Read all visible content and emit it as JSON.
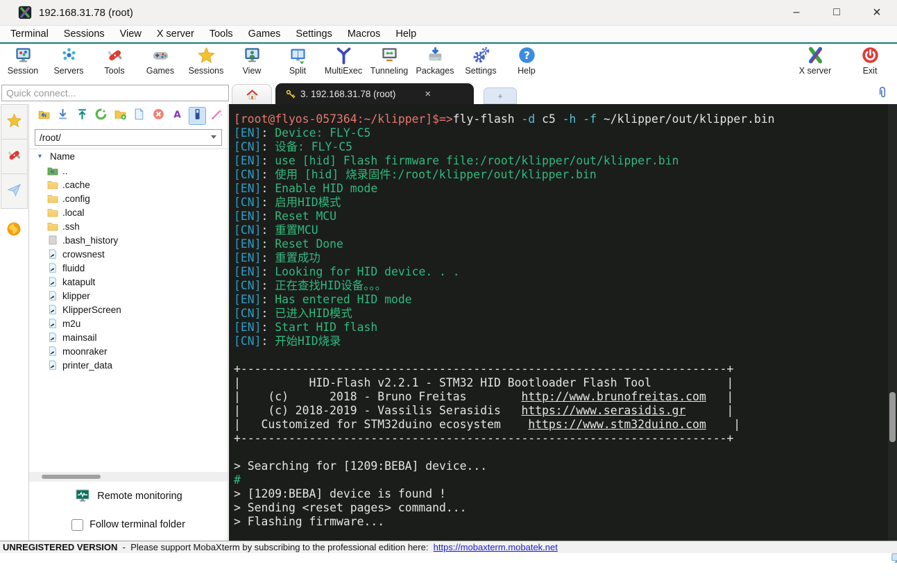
{
  "window": {
    "title": "192.168.31.78 (root)",
    "controls": {
      "minimize": "–",
      "maximize": "□",
      "close": "×"
    }
  },
  "colors": {
    "accent_teal": "#147c7c",
    "terminal_background": "#1b1d1b",
    "prompt_salmon": "#e8796e",
    "tag_blue": "#2d9dc4",
    "text_green": "#2eba7e",
    "flag_cyan": "#4fc3dc",
    "terminal_white": "#e4e4e4",
    "link_blue": "#1b1bd6"
  },
  "menubar": {
    "items": [
      {
        "label": "Terminal"
      },
      {
        "label": "Sessions"
      },
      {
        "label": "View"
      },
      {
        "label": "X server"
      },
      {
        "label": "Tools"
      },
      {
        "label": "Games"
      },
      {
        "label": "Settings"
      },
      {
        "label": "Macros"
      },
      {
        "label": "Help"
      }
    ]
  },
  "toolbar": {
    "buttons": [
      {
        "label": "Session",
        "icon": "session-monitor-icon"
      },
      {
        "label": "Servers",
        "icon": "servers-network-icon"
      },
      {
        "label": "Tools",
        "icon": "swiss-knife-icon"
      },
      {
        "label": "Games",
        "icon": "gamepad-icon"
      },
      {
        "label": "Sessions",
        "icon": "star-icon"
      },
      {
        "label": "View",
        "icon": "view-monitor-icon"
      },
      {
        "label": "Split",
        "icon": "split-window-icon"
      },
      {
        "label": "MultiExec",
        "icon": "multiexec-y-icon"
      },
      {
        "label": "Tunneling",
        "icon": "tunneling-monitor-icon"
      },
      {
        "label": "Packages",
        "icon": "packages-drive-icon"
      },
      {
        "label": "Settings",
        "icon": "gears-icon"
      },
      {
        "label": "Help",
        "icon": "help-circle-icon"
      }
    ],
    "right_buttons": [
      {
        "label": "X server",
        "icon": "xserver-x-icon"
      },
      {
        "label": "Exit",
        "icon": "power-icon"
      }
    ]
  },
  "quick_connect": {
    "placeholder": "Quick connect..."
  },
  "tabs": {
    "active": {
      "label": "3. 192.168.31.78 (root)",
      "close_glyph": "×"
    },
    "new_tab_glyph": "+"
  },
  "sidebar": {
    "rail": [
      {
        "name": "sessions",
        "icon": "star-icon"
      },
      {
        "name": "tools",
        "icon": "swiss-knife-icon"
      },
      {
        "name": "macros",
        "icon": "paper-plane-icon"
      },
      {
        "name": "sftp",
        "icon": "globe-icon"
      }
    ],
    "filebar": [
      {
        "icon": "parent-folder-icon"
      },
      {
        "icon": "download-icon"
      },
      {
        "icon": "upload-icon"
      },
      {
        "icon": "refresh-icon"
      },
      {
        "icon": "new-folder-icon"
      },
      {
        "icon": "new-file-icon"
      },
      {
        "icon": "delete-icon"
      },
      {
        "icon": "font-icon"
      },
      {
        "icon": "sync-icon",
        "selected": true
      },
      {
        "icon": "wand-icon"
      }
    ],
    "path": "/root/",
    "tree": {
      "header": "Name",
      "rows": [
        {
          "label": "..",
          "icon": "parent-dir-icon"
        },
        {
          "label": ".cache",
          "icon": "folder-icon"
        },
        {
          "label": ".config",
          "icon": "folder-icon"
        },
        {
          "label": ".local",
          "icon": "folder-icon"
        },
        {
          "label": ".ssh",
          "icon": "folder-icon"
        },
        {
          "label": ".bash_history",
          "icon": "file-icon"
        },
        {
          "label": "crowsnest",
          "icon": "symlink-icon"
        },
        {
          "label": "fluidd",
          "icon": "symlink-icon"
        },
        {
          "label": "katapult",
          "icon": "symlink-icon"
        },
        {
          "label": "klipper",
          "icon": "symlink-icon"
        },
        {
          "label": "KlipperScreen",
          "icon": "symlink-icon"
        },
        {
          "label": "m2u",
          "icon": "symlink-icon"
        },
        {
          "label": "mainsail",
          "icon": "symlink-icon"
        },
        {
          "label": "moonraker",
          "icon": "symlink-icon"
        },
        {
          "label": "printer_data",
          "icon": "symlink-icon"
        }
      ]
    },
    "remote_monitoring_label": "Remote monitoring",
    "follow_terminal_label": "Follow terminal folder"
  },
  "terminal": {
    "lines": [
      {
        "segments": [
          {
            "t": "[root@flyos-057364:~/klipper]$=>",
            "c": "p"
          },
          {
            "t": "fly-flash ",
            "c": "w"
          },
          {
            "t": "-d ",
            "c": "c"
          },
          {
            "t": "c5 ",
            "c": "w"
          },
          {
            "t": "-h ",
            "c": "c"
          },
          {
            "t": "-f ",
            "c": "c"
          },
          {
            "t": "~/klipper/out/klipper.bin",
            "c": "w"
          }
        ]
      },
      {
        "segments": [
          {
            "t": "[EN]",
            "c": "b"
          },
          {
            "t": ": ",
            "c": "w"
          },
          {
            "t": "Device: FLY-C5",
            "c": "g"
          }
        ]
      },
      {
        "segments": [
          {
            "t": "[CN]",
            "c": "b"
          },
          {
            "t": ": ",
            "c": "w"
          },
          {
            "t": "设备: FLY-C5",
            "c": "g"
          }
        ]
      },
      {
        "segments": [
          {
            "t": "[EN]",
            "c": "b"
          },
          {
            "t": ": ",
            "c": "w"
          },
          {
            "t": "use [hid] Flash firmware file:/root/klipper/out/klipper.bin",
            "c": "g"
          }
        ]
      },
      {
        "segments": [
          {
            "t": "[CN]",
            "c": "b"
          },
          {
            "t": ": ",
            "c": "w"
          },
          {
            "t": "使用 [hid] 烧录固件:/root/klipper/out/klipper.bin",
            "c": "g"
          }
        ]
      },
      {
        "segments": [
          {
            "t": "[EN]",
            "c": "b"
          },
          {
            "t": ": ",
            "c": "w"
          },
          {
            "t": "Enable HID mode",
            "c": "g"
          }
        ]
      },
      {
        "segments": [
          {
            "t": "[CN]",
            "c": "b"
          },
          {
            "t": ": ",
            "c": "w"
          },
          {
            "t": "启用HID模式",
            "c": "g"
          }
        ]
      },
      {
        "segments": [
          {
            "t": "[EN]",
            "c": "b"
          },
          {
            "t": ": ",
            "c": "w"
          },
          {
            "t": "Reset MCU",
            "c": "g"
          }
        ]
      },
      {
        "segments": [
          {
            "t": "[CN]",
            "c": "b"
          },
          {
            "t": ": ",
            "c": "w"
          },
          {
            "t": "重置MCU",
            "c": "g"
          }
        ]
      },
      {
        "segments": [
          {
            "t": "[EN]",
            "c": "b"
          },
          {
            "t": ": ",
            "c": "w"
          },
          {
            "t": "Reset Done",
            "c": "g"
          }
        ]
      },
      {
        "segments": [
          {
            "t": "[EN]",
            "c": "b"
          },
          {
            "t": ": ",
            "c": "w"
          },
          {
            "t": "重置成功",
            "c": "g"
          }
        ]
      },
      {
        "segments": [
          {
            "t": "[EN]",
            "c": "b"
          },
          {
            "t": ": ",
            "c": "w"
          },
          {
            "t": "Looking for HID device. . .",
            "c": "g"
          }
        ]
      },
      {
        "segments": [
          {
            "t": "[CN]",
            "c": "b"
          },
          {
            "t": ": ",
            "c": "w"
          },
          {
            "t": "正在查找HID设备。。。",
            "c": "g"
          }
        ]
      },
      {
        "segments": [
          {
            "t": "[EN]",
            "c": "b"
          },
          {
            "t": ": ",
            "c": "w"
          },
          {
            "t": "Has entered HID mode",
            "c": "g"
          }
        ]
      },
      {
        "segments": [
          {
            "t": "[CN]",
            "c": "b"
          },
          {
            "t": ": ",
            "c": "w"
          },
          {
            "t": "已进入HID模式",
            "c": "g"
          }
        ]
      },
      {
        "segments": [
          {
            "t": "[EN]",
            "c": "b"
          },
          {
            "t": ": ",
            "c": "w"
          },
          {
            "t": "Start HID flash",
            "c": "g"
          }
        ]
      },
      {
        "segments": [
          {
            "t": "[CN]",
            "c": "b"
          },
          {
            "t": ": ",
            "c": "w"
          },
          {
            "t": "开始HID烧录",
            "c": "g"
          }
        ]
      },
      {
        "segments": []
      },
      {
        "segments": [
          {
            "t": "+-----------------------------------------------------------------------+",
            "c": "w"
          }
        ]
      },
      {
        "segments": [
          {
            "t": "|          HID-Flash v2.2.1 - STM32 HID Bootloader Flash Tool           |",
            "c": "w"
          }
        ]
      },
      {
        "segments": [
          {
            "t": "|    (c)      2018 - Bruno Freitas        ",
            "c": "w"
          },
          {
            "t": "http://www.brunofreitas.com",
            "c": "u"
          },
          {
            "t": "   |",
            "c": "w"
          }
        ]
      },
      {
        "segments": [
          {
            "t": "|    (c) 2018-2019 - Vassilis Serasidis   ",
            "c": "w"
          },
          {
            "t": "https://www.serasidis.gr",
            "c": "u"
          },
          {
            "t": "      |",
            "c": "w"
          }
        ]
      },
      {
        "segments": [
          {
            "t": "|   Customized for STM32duino ecosystem    ",
            "c": "w"
          },
          {
            "t": "https://www.stm32duino.com",
            "c": "u"
          },
          {
            "t": "    |",
            "c": "w"
          }
        ]
      },
      {
        "segments": [
          {
            "t": "+-----------------------------------------------------------------------+",
            "c": "w"
          }
        ]
      },
      {
        "segments": []
      },
      {
        "segments": [
          {
            "t": "> Searching for [1209:BEBA] device...",
            "c": "w"
          }
        ]
      },
      {
        "segments": [
          {
            "t": "#",
            "c": "g"
          }
        ]
      },
      {
        "segments": [
          {
            "t": "> [1209:BEBA] device is found !",
            "c": "w"
          }
        ]
      },
      {
        "segments": [
          {
            "t": "> Sending <reset pages> command...",
            "c": "w"
          }
        ]
      },
      {
        "segments": [
          {
            "t": "> Flashing firmware...",
            "c": "w"
          }
        ]
      }
    ]
  },
  "statusbar": {
    "version_label": "UNREGISTERED VERSION",
    "separator": "  -  ",
    "message": "Please support MobaXterm by subscribing to the professional edition here:  ",
    "link": "https://mobaxterm.mobatek.net"
  }
}
